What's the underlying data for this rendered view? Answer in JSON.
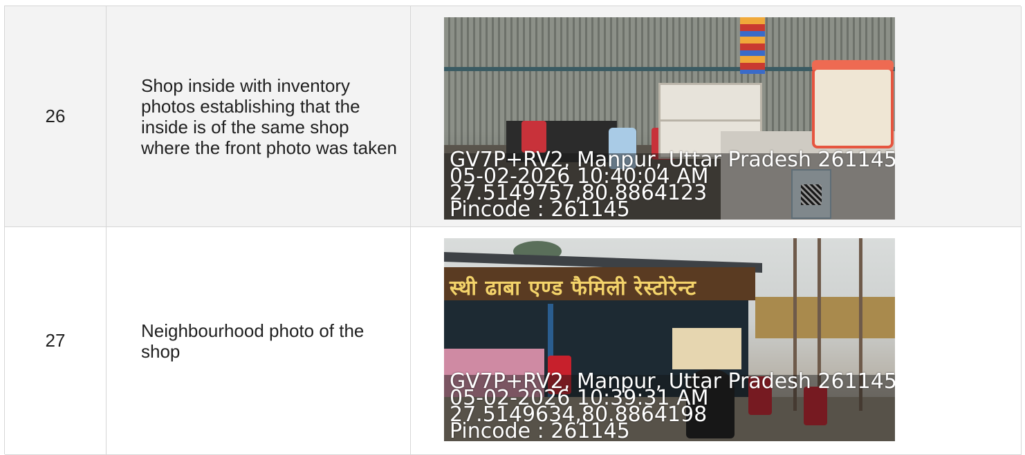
{
  "rows": [
    {
      "number": "26",
      "description": "Shop inside with inventory photos establishing that the inside is of the same shop where the front photo was taken",
      "photo": {
        "overlay": {
          "address": "GV7P+RV2, Manpur, Uttar Pradesh 261145",
          "datetime": "05-02-2026 10:40:04 AM",
          "coords": "27.5149757,80.8864123",
          "pincode": "Pincode : 261145"
        }
      }
    },
    {
      "number": "27",
      "description": "Neighbourhood photo of the shop",
      "photo": {
        "sign_text": "स्थी ढाबा एण्ड फैमिली रेस्टोरेन्ट",
        "overlay": {
          "address": "GV7P+RV2, Manpur, Uttar Pradesh 261145",
          "datetime": "05-02-2026 10:39:31 AM",
          "coords": "27.5149634,80.8864198",
          "pincode": "Pincode : 261145"
        }
      }
    }
  ],
  "colors": {
    "row_alt_bg": "#f3f3f3",
    "border": "#d6d6d6",
    "text": "#1f1f1f"
  }
}
